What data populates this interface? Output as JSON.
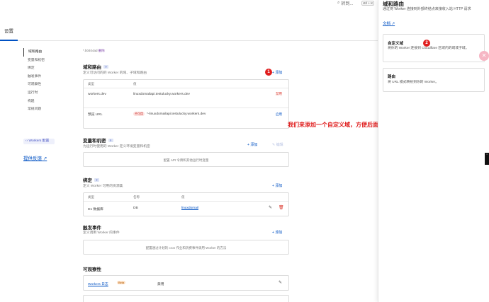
{
  "topbar": {
    "search_placeholder": "转到...",
    "search_shortcut": "ctrl + K"
  },
  "tabs": [
    {
      "label": "设置"
    }
  ],
  "sidebar": {
    "items": [
      {
        "label": "域和路由",
        "active": true
      },
      {
        "label": "变量和机密"
      },
      {
        "label": "绑定"
      },
      {
        "label": "触发事件"
      },
      {
        "label": "可观察性"
      },
      {
        "label": "运行时"
      },
      {
        "label": "构建"
      },
      {
        "label": "常规问题"
      }
    ],
    "workers_badge": "Workers 配置",
    "feedback": "提供反馈"
  },
  "main": {
    "subdomain": {
      "value": "*.b0404ad",
      "link": "删除"
    },
    "routes": {
      "title": "域和路由",
      "desc": "定义可访问的的 Worker 的域、子域和路由",
      "add": "添加",
      "headers": {
        "type": "类型",
        "value": "值"
      },
      "rows": [
        {
          "type": "workers.dev",
          "value": "linuxdomailapi.testulucky.workers.dev",
          "action": "禁用"
        },
        {
          "type": "预览 URL",
          "tag": "不可用",
          "value": "*-linuxdomailapi.testulucky.workers.dev",
          "action": "启用"
        }
      ]
    },
    "variables": {
      "title": "变量和机密",
      "desc": "为运行时使用的 Worker 定义环境变量和机密",
      "add": "添加",
      "edit": "编辑",
      "empty": "配置 API 令牌和其他运行时变量"
    },
    "bindings": {
      "title": "绑定",
      "desc": "定义 Worker 可用的资源集",
      "add": "添加",
      "headers": {
        "type": "类型",
        "name": "名称",
        "value": "值"
      },
      "rows": [
        {
          "type": "D1 数据库",
          "name": "DB",
          "value": "linuxdomail"
        }
      ]
    },
    "triggers": {
      "title": "触发事件",
      "desc": "定义调用 Worker 的事件",
      "add": "添加",
      "empty": "配置通过计划的 cron 作业和消费事件调用 Worker 的方法"
    },
    "observability": {
      "title": "可观察性",
      "logs_label": "Workers 日志",
      "beta": "Beta",
      "logs_status": "禁用"
    }
  },
  "annotation": {
    "badge1": "1",
    "badge2": "2",
    "text": "我们来添加一个自定义域，方便后面我们调用API"
  },
  "panel": {
    "title": "域和路由",
    "desc": "通过将 Worker 连接到外部终结点来接收入站 HTTP 请求",
    "doc": "文档",
    "options": [
      {
        "title": "自定义域",
        "desc": "将你的 Worker 连接到 Cloudflare 区域内的域或子域。"
      },
      {
        "title": "路由",
        "desc": "将 URL 模式映射到你的 Worker。"
      }
    ]
  }
}
